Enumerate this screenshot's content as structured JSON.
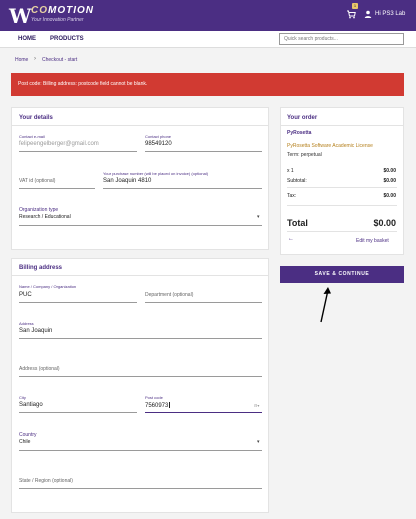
{
  "header": {
    "logo_letter": "W",
    "brand_prefix": "CO",
    "brand_suffix": "MOTION",
    "tagline": "Your Innovation Partner",
    "cart_count": "1",
    "user_label": "Hi PS3 Lab"
  },
  "nav": {
    "home": "HOME",
    "products": "PRODUCTS",
    "search_placeholder": "Quick search products..."
  },
  "breadcrumb": {
    "home": "Home",
    "separator": "›",
    "current": "Checkout - start"
  },
  "error_message": "Post code: Billing address: postcode field cannot be blank.",
  "your_details": {
    "title": "Your details",
    "email_label": "Contact e-mail",
    "email_value": "felipeengelberger@gmail.com",
    "phone_label": "Contact phone",
    "phone_value": "98549120",
    "vat_placeholder": "VAT id (optional)",
    "po_label": "Your purchase number (will be placed on invoice) (optional)",
    "po_value": "San Joaquin 4810",
    "org_type_label": "Organization type",
    "org_type_value": "Research / Educational"
  },
  "billing": {
    "title": "Billing address",
    "name_label": "Name / Company / Organization",
    "name_value": "PUC",
    "department_placeholder": "Department (optional)",
    "address_label": "Address",
    "address_value": "San Joaquin",
    "address2_placeholder": "Address (optional)",
    "city_label": "City",
    "city_value": "Santiago",
    "postcode_label": "Post code",
    "postcode_value": "7560973",
    "country_label": "Country",
    "country_value": "Chile",
    "state_placeholder": "State / Region (optional)"
  },
  "order": {
    "title": "Your order",
    "product_title": "PyRosetta",
    "product_license": "PyRosetta Software Academic License",
    "term": "Term: perpetual",
    "qty": "x 1",
    "qty_price": "$0.00",
    "subtotal_label": "Subtotal:",
    "subtotal_value": "$0.00",
    "tax_label": "Tax:",
    "tax_value": "$0.00",
    "total_label": "Total",
    "total_value": "$0.00",
    "back_icon": "arrow-left",
    "edit_basket": "Edit my basket"
  },
  "actions": {
    "save_continue": "SAVE & CONTINUE"
  },
  "colors": {
    "brand": "#4b2e83",
    "error": "#d13a32",
    "accent": "#b5801d"
  }
}
